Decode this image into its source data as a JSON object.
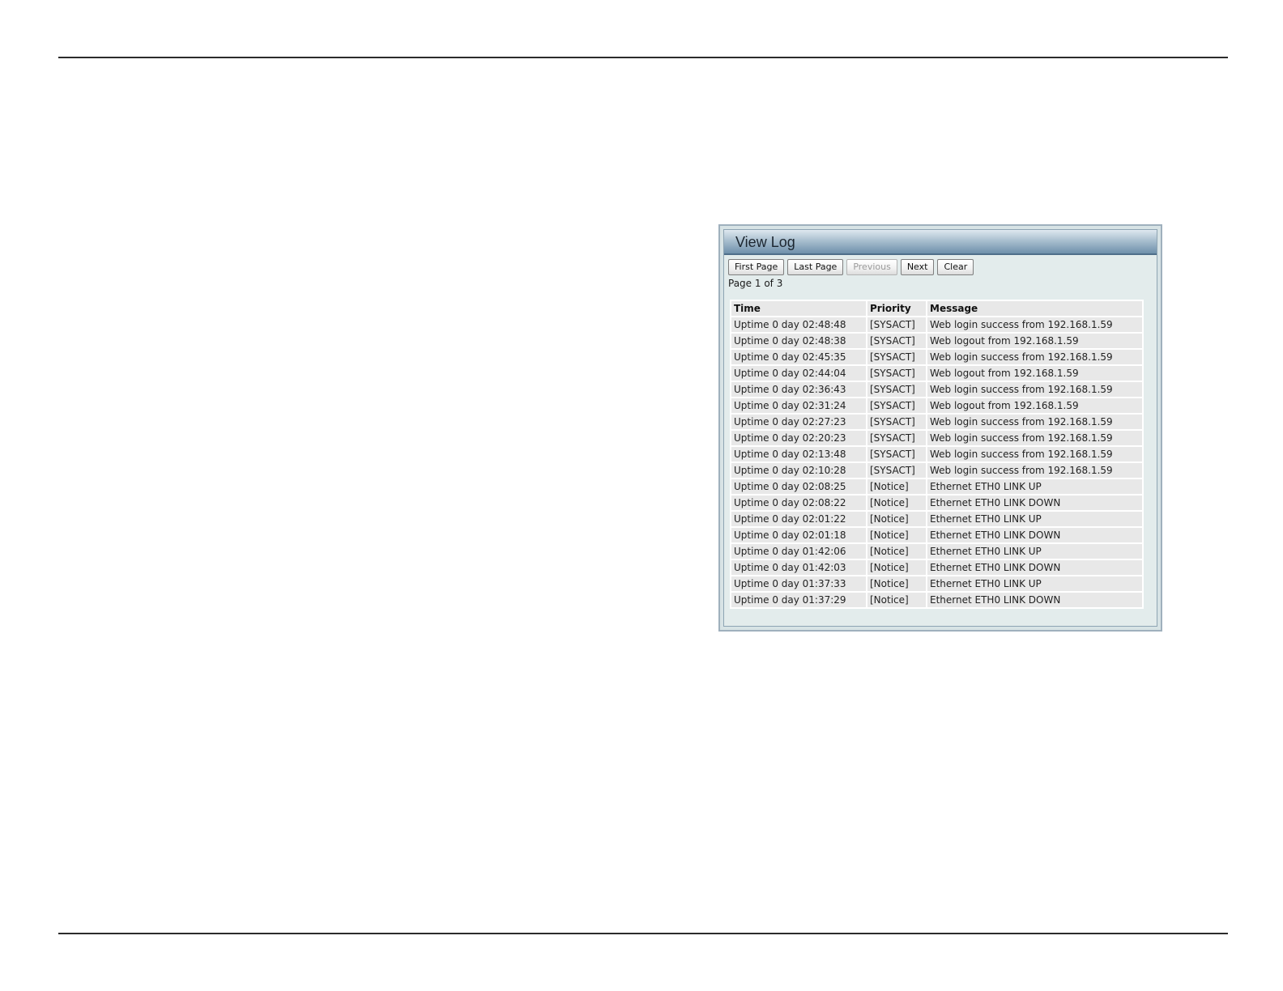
{
  "window": {
    "title": "View Log"
  },
  "toolbar": {
    "first_page_label": "First Page",
    "last_page_label": "Last Page",
    "previous_label": "Previous",
    "next_label": "Next",
    "clear_label": "Clear"
  },
  "pagination": {
    "text": "Page 1 of 3"
  },
  "table": {
    "headers": {
      "time": "Time",
      "priority": "Priority",
      "message": "Message"
    },
    "rows": [
      {
        "time": "Uptime 0 day 02:48:48",
        "priority": "[SYSACT]",
        "message": "Web login success from 192.168.1.59"
      },
      {
        "time": "Uptime 0 day 02:48:38",
        "priority": "[SYSACT]",
        "message": "Web logout from 192.168.1.59"
      },
      {
        "time": "Uptime 0 day 02:45:35",
        "priority": "[SYSACT]",
        "message": "Web login success from 192.168.1.59"
      },
      {
        "time": "Uptime 0 day 02:44:04",
        "priority": "[SYSACT]",
        "message": "Web logout from 192.168.1.59"
      },
      {
        "time": "Uptime 0 day 02:36:43",
        "priority": "[SYSACT]",
        "message": "Web login success from 192.168.1.59"
      },
      {
        "time": "Uptime 0 day 02:31:24",
        "priority": "[SYSACT]",
        "message": "Web logout from 192.168.1.59"
      },
      {
        "time": "Uptime 0 day 02:27:23",
        "priority": "[SYSACT]",
        "message": "Web login success from 192.168.1.59"
      },
      {
        "time": "Uptime 0 day 02:20:23",
        "priority": "[SYSACT]",
        "message": "Web login success from 192.168.1.59"
      },
      {
        "time": "Uptime 0 day 02:13:48",
        "priority": "[SYSACT]",
        "message": "Web login success from 192.168.1.59"
      },
      {
        "time": "Uptime 0 day 02:10:28",
        "priority": "[SYSACT]",
        "message": "Web login success from 192.168.1.59"
      },
      {
        "time": "Uptime 0 day 02:08:25",
        "priority": "[Notice]",
        "message": "Ethernet ETH0 LINK UP"
      },
      {
        "time": "Uptime 0 day 02:08:22",
        "priority": "[Notice]",
        "message": "Ethernet ETH0 LINK DOWN"
      },
      {
        "time": "Uptime 0 day 02:01:22",
        "priority": "[Notice]",
        "message": "Ethernet ETH0 LINK UP"
      },
      {
        "time": "Uptime 0 day 02:01:18",
        "priority": "[Notice]",
        "message": "Ethernet ETH0 LINK DOWN"
      },
      {
        "time": "Uptime 0 day 01:42:06",
        "priority": "[Notice]",
        "message": "Ethernet ETH0 LINK UP"
      },
      {
        "time": "Uptime 0 day 01:42:03",
        "priority": "[Notice]",
        "message": "Ethernet ETH0 LINK DOWN"
      },
      {
        "time": "Uptime 0 day 01:37:33",
        "priority": "[Notice]",
        "message": "Ethernet ETH0 LINK UP"
      },
      {
        "time": "Uptime 0 day 01:37:29",
        "priority": "[Notice]",
        "message": "Ethernet ETH0 LINK DOWN"
      }
    ]
  }
}
